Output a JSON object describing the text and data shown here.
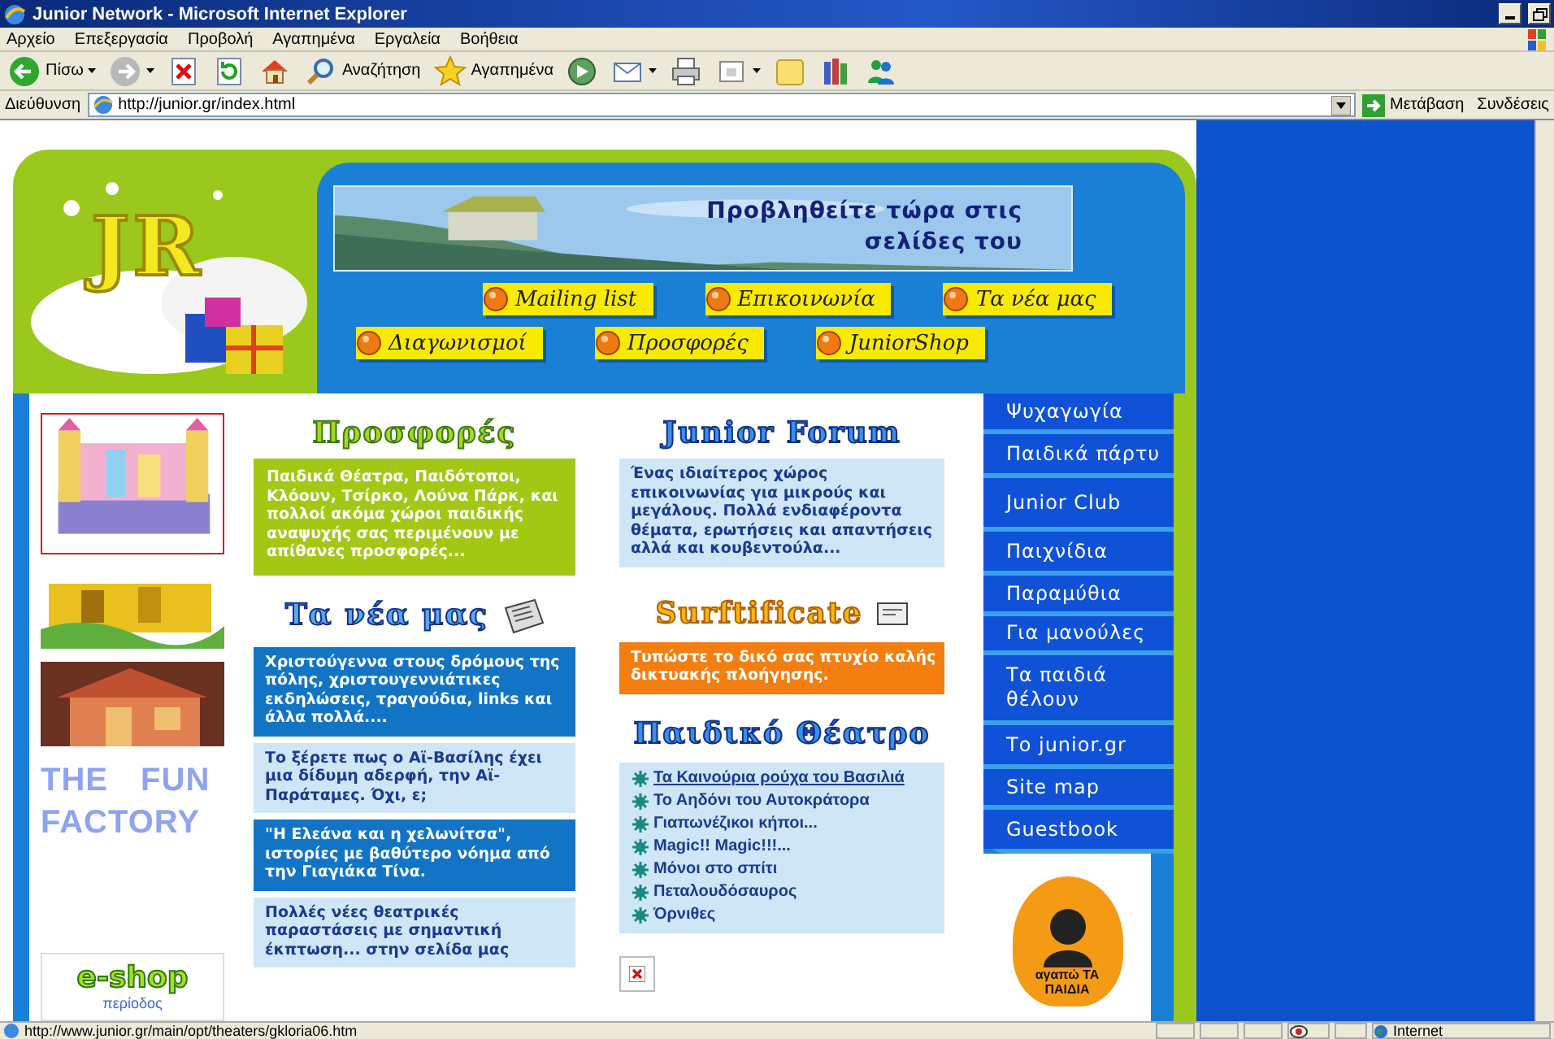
{
  "window": {
    "title": "Junior Network - Microsoft Internet Explorer"
  },
  "menu": [
    "Αρχείο",
    "Επεξεργασία",
    "Προβολή",
    "Αγαπημένα",
    "Εργαλεία",
    "Βοήθεια"
  ],
  "toolbar": [
    {
      "kind": "back",
      "label": "Πίσω",
      "dropdown": true
    },
    {
      "kind": "forward",
      "dropdown": true
    },
    {
      "kind": "stop",
      "dropdown": false
    },
    {
      "kind": "refresh",
      "dropdown": false
    },
    {
      "kind": "home",
      "dropdown": false
    },
    {
      "kind": "search",
      "label": "Αναζήτηση",
      "dropdown": false
    },
    {
      "kind": "favorites",
      "label": "Αγαπημένα",
      "dropdown": false
    },
    {
      "kind": "media",
      "dropdown": false
    },
    {
      "kind": "mail",
      "dropdown": true
    },
    {
      "kind": "print",
      "dropdown": false
    },
    {
      "kind": "edit",
      "dropdown": true
    },
    {
      "kind": "folder",
      "dropdown": false
    },
    {
      "kind": "research",
      "dropdown": false
    },
    {
      "kind": "messenger",
      "dropdown": false
    }
  ],
  "address_bar": {
    "label": "Διεύθυνση",
    "value": "http://junior.gr/index.html",
    "go": "Μετάβαση",
    "links": "Συνδέσεις"
  },
  "page": {
    "logo": "JR",
    "banner": "Προβληθείτε τώρα στις σελίδες του",
    "nav_rows": [
      {
        "items": [
          "Mailing list",
          "Επικοινωνία",
          "Τα νέα μας"
        ]
      },
      {
        "items": [
          "Διαγωνισμοί",
          "Προσφορές",
          "JuniorShop"
        ]
      }
    ],
    "fun_factory": "THE FUN FACTORY",
    "eshop": {
      "title": "e-shop",
      "subtitle": "περίοδος"
    },
    "offers": {
      "heading": "Προσφορές",
      "text": "Παιδικά Θέατρα, Παιδότοποι, Κλόουν, Τσίρκο, Λούνα Πάρκ, και πολλοί ακόμα χώροι παιδικής αναψυχής σας περιμένουν με απίθανες προσφορές..."
    },
    "news": {
      "heading": "Τα νέα μας",
      "items": [
        {
          "kind": "dark",
          "text": "Χριστούγεννα στους δρόμους της πόλης, χριστουγεννιάτικες εκδηλώσεις, τραγούδια, links και άλλα πολλά...."
        },
        {
          "kind": "light",
          "text": "Το ξέρετε πως ο Αϊ-Βασίλης έχει μια δίδυμη αδερφή, την Αϊ-Παράταμες. Όχι, ε;"
        },
        {
          "kind": "dark",
          "text": "\"Η Ελεάνα και η χελωνίτσα\", ιστορίες με βαθύτερο νόημα από την Γιαγιάκα Τίνα."
        },
        {
          "kind": "light",
          "text": "Πολλές νέες θεατρικές παραστάσεις με σημαντική έκπτωση... στην σελίδα μας"
        }
      ]
    },
    "forum": {
      "heading": "Junior Forum",
      "text": "Ένας ιδιαίτερος χώρος επικοινωνίας για μικρούς και μεγάλους. Πολλά ενδιαφέροντα θέματα, ερωτήσεις και απαντήσεις αλλά και κουβεντούλα..."
    },
    "surftificate": {
      "heading": "Surftificate",
      "text": "Τυπώστε το δικό σας πτυχίο καλής δικτυακής πλοήγησης."
    },
    "theatre": {
      "heading": "Παιδικό Θέατρο",
      "items": [
        {
          "text": "Τα Καινούρια ρούχα του Βασιλιά",
          "underlined": true
        },
        {
          "text": "Το Αηδόνι του Αυτοκράτορα",
          "underlined": false
        },
        {
          "text": "Γιαπωνέζικοι κήποι...",
          "underlined": false
        },
        {
          "text": "Magic!! Magic!!!...",
          "underlined": false
        },
        {
          "text": "Μόνοι στο σπίτι",
          "underlined": false
        },
        {
          "text": "Πεταλουδόσαυρος",
          "underlined": false
        },
        {
          "text": "Όρνιθες",
          "underlined": false
        }
      ]
    },
    "side_menu": [
      "Ψυχαγωγία",
      "Παιδικά πάρτυ",
      "Junior Club",
      "Παιχνίδια",
      "Παραμύθια",
      "Για μανούλες",
      "Τα παιδιά θέλουν",
      "Το junior.gr",
      "Site map",
      "Guestbook"
    ],
    "badge": "αγαπώ ΤΑ ΠΑΙΔΙΑ"
  },
  "status_bar": {
    "url": "http://www.junior.gr/main/opt/theaters/gkloria06.htm",
    "zone": "Internet"
  }
}
